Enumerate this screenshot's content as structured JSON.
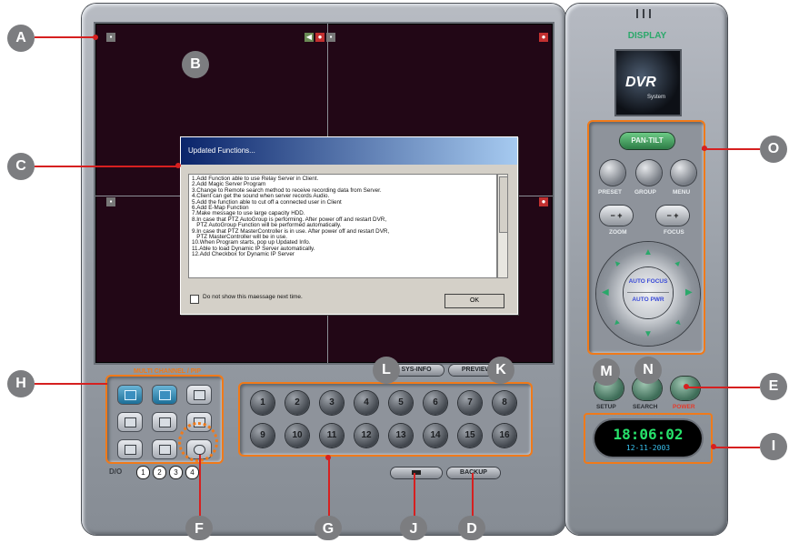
{
  "display_title": "DISPLAY",
  "logo": {
    "big": "DVR",
    "small": "System"
  },
  "dialog": {
    "title": "Updated Functions...",
    "lines": [
      "1.Add Function able to use Relay Server in Client.",
      "2.Add Magic Server Program",
      "3.Change to Remote search method to receive recording data from Server.",
      "4.Client can get the sound when server records Audio.",
      "5.Add the function able to cut off a connected user in Client",
      "6.Add E-Map Function",
      "7.Make message to use large capacity HDD.",
      "8.In case that PTZ AutoGroup is performing. After power off and restart DVR,",
      "   PTZ AutoGroup Function will be performed automatically.",
      "9.In case that PTZ MasterController is in use. After power off and restart DVR,",
      "   PTZ MasterController will be in use.",
      "10.When Program starts, pop up Updated Info.",
      "11.Able to load Dynamic IP Server automatically.",
      "12.Add Checkbox for Dynamic IP Server"
    ],
    "checkbox_label": "Do not show this maessage next time.",
    "ok_label": "OK"
  },
  "multichannel_title": "MULTI CHANNEL / PIP",
  "channels": [
    "1",
    "2",
    "3",
    "4",
    "5",
    "6",
    "7",
    "8",
    "9",
    "10",
    "11",
    "12",
    "13",
    "14",
    "15",
    "16"
  ],
  "buttons": {
    "sys_info": "SYS-INFO",
    "preview": "PREVIEW",
    "backup": "BACKUP"
  },
  "io": {
    "label": "D/O",
    "items": [
      "1",
      "2",
      "3",
      "4"
    ]
  },
  "ptz": {
    "pan_tilt": "PAN-TILT",
    "preset": "PRESET",
    "group": "GROUP",
    "menu": "MENU",
    "zoom": "ZOOM",
    "focus": "FOCUS",
    "minus": "−",
    "plus": "+",
    "auto_focus": "AUTO FOCUS",
    "auto_pwr": "AUTO PWR"
  },
  "controls": {
    "setup": "SETUP",
    "search": "SEARCH",
    "power": "POWER"
  },
  "clock": {
    "time": "18:06:02",
    "date": "12-11-2003"
  },
  "markers": {
    "A": "A",
    "B": "B",
    "C": "C",
    "D": "D",
    "E": "E",
    "F": "F",
    "G": "G",
    "H": "H",
    "I": "I",
    "J": "J",
    "K": "K",
    "L": "L",
    "M": "M",
    "N": "N",
    "O": "O"
  },
  "colors": {
    "accent": "#f07a1a",
    "marker": "#7c7d80",
    "leader": "#d62020",
    "screen": "#220716",
    "clock_time": "#27e36b",
    "clock_date": "#39c2f0",
    "power_label": "#e53a2a"
  }
}
